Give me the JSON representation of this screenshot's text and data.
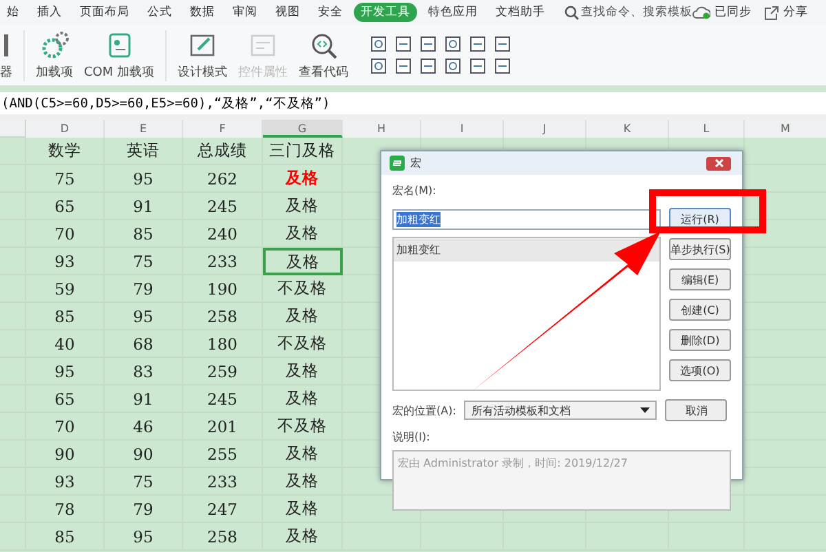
{
  "menu": {
    "tabs": [
      {
        "label": "始",
        "selected": false
      },
      {
        "label": "插入",
        "selected": false
      },
      {
        "label": "页面布局",
        "selected": false
      },
      {
        "label": "公式",
        "selected": false
      },
      {
        "label": "数据",
        "selected": false
      },
      {
        "label": "审阅",
        "selected": false
      },
      {
        "label": "视图",
        "selected": false
      },
      {
        "label": "安全",
        "selected": false
      },
      {
        "label": "开发工具",
        "selected": true
      },
      {
        "label": "特色应用",
        "selected": false
      },
      {
        "label": "文档助手",
        "selected": false
      }
    ],
    "search": {
      "placeholder": "查找命令、搜索模板"
    },
    "sync": "已同步",
    "share": "分享"
  },
  "ribbon": [
    {
      "label": "器",
      "kind": "cut",
      "disabled": false
    },
    {
      "label": "加载项",
      "kind": "addin",
      "disabled": false
    },
    {
      "label": "COM 加载项",
      "kind": "com",
      "disabled": false
    },
    {
      "label": "设计模式",
      "kind": "design",
      "disabled": false
    },
    {
      "label": "控件属性",
      "kind": "props",
      "disabled": true
    },
    {
      "label": "查看代码",
      "kind": "code",
      "disabled": false
    }
  ],
  "formula": "(AND(C5>=60,D5>=60,E5>=60),“及格”,“不及格”)",
  "sheet": {
    "columns": [
      {
        "label": "D",
        "selected": false
      },
      {
        "label": "E",
        "selected": false
      },
      {
        "label": "F",
        "selected": false
      },
      {
        "label": "G",
        "selected": true
      },
      {
        "label": "H",
        "selected": false
      },
      {
        "label": "I",
        "selected": false
      },
      {
        "label": "J",
        "selected": false
      },
      {
        "label": "K",
        "selected": false
      },
      {
        "label": "L",
        "selected": false
      },
      {
        "label": "M",
        "selected": false
      }
    ],
    "headers": [
      "数学",
      "英语",
      "总成绩",
      "三门及格"
    ],
    "rows": [
      {
        "cells": [
          "75",
          "95",
          "262",
          "及格"
        ],
        "highlighted": true,
        "selected": false
      },
      {
        "cells": [
          "65",
          "91",
          "245",
          "及格"
        ],
        "highlighted": false,
        "selected": false
      },
      {
        "cells": [
          "70",
          "85",
          "240",
          "及格"
        ],
        "highlighted": false,
        "selected": false
      },
      {
        "cells": [
          "93",
          "75",
          "233",
          "及格"
        ],
        "highlighted": false,
        "selected": true
      },
      {
        "cells": [
          "59",
          "79",
          "190",
          "不及格"
        ],
        "highlighted": false,
        "selected": false
      },
      {
        "cells": [
          "85",
          "95",
          "258",
          "及格"
        ],
        "highlighted": false,
        "selected": false
      },
      {
        "cells": [
          "40",
          "68",
          "180",
          "不及格"
        ],
        "highlighted": false,
        "selected": false
      },
      {
        "cells": [
          "95",
          "83",
          "259",
          "及格"
        ],
        "highlighted": false,
        "selected": false
      },
      {
        "cells": [
          "65",
          "91",
          "245",
          "及格"
        ],
        "highlighted": false,
        "selected": false
      },
      {
        "cells": [
          "70",
          "46",
          "201",
          "不及格"
        ],
        "highlighted": false,
        "selected": false
      },
      {
        "cells": [
          "90",
          "90",
          "255",
          "及格"
        ],
        "highlighted": false,
        "selected": false
      },
      {
        "cells": [
          "93",
          "75",
          "233",
          "及格"
        ],
        "highlighted": false,
        "selected": false
      },
      {
        "cells": [
          "78",
          "79",
          "247",
          "及格"
        ],
        "highlighted": false,
        "selected": false
      },
      {
        "cells": [
          "85",
          "95",
          "258",
          "及格"
        ],
        "highlighted": false,
        "selected": false
      }
    ]
  },
  "dialog": {
    "title": "宏",
    "name_label": "宏名(M):",
    "name_value": "加粗变红",
    "macros": [
      {
        "label": "加粗变红",
        "selected": true
      }
    ],
    "buttons": [
      {
        "label": "运行(R)",
        "highlighted": true
      },
      {
        "label": "单步执行(S)",
        "highlighted": false
      },
      {
        "label": "编辑(E)",
        "highlighted": false
      },
      {
        "label": "创建(C)",
        "highlighted": false
      },
      {
        "label": "删除(D)",
        "highlighted": false
      },
      {
        "label": "选项(O)",
        "highlighted": false
      }
    ],
    "location_label": "宏的位置(A):",
    "location_value": "所有活动模板和文档",
    "cancel": "取消",
    "description_label": "说明(I):",
    "description": "宏由 Administrator 录制，时间: 2019/12/27"
  }
}
